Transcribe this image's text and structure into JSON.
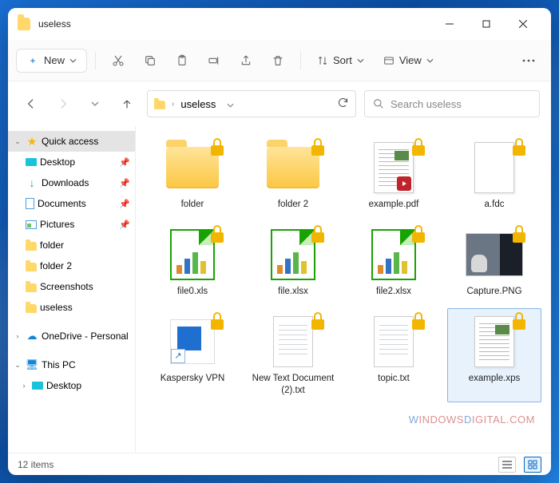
{
  "window": {
    "title": "useless"
  },
  "toolbar": {
    "new_label": "New",
    "sort_label": "Sort",
    "view_label": "View"
  },
  "nav": {
    "breadcrumb": "useless",
    "search_placeholder": "Search useless"
  },
  "sidebar": {
    "items": [
      {
        "label": "Quick access",
        "icon": "star",
        "expanded": true,
        "selected": true
      },
      {
        "label": "Desktop",
        "icon": "desk",
        "pinned": true
      },
      {
        "label": "Downloads",
        "icon": "down",
        "pinned": true
      },
      {
        "label": "Documents",
        "icon": "doc",
        "pinned": true
      },
      {
        "label": "Pictures",
        "icon": "pic",
        "pinned": true
      },
      {
        "label": "folder",
        "icon": "folder"
      },
      {
        "label": "folder 2",
        "icon": "folder"
      },
      {
        "label": "Screenshots",
        "icon": "folder"
      },
      {
        "label": "useless",
        "icon": "folder"
      },
      {
        "label": "OneDrive - Personal",
        "icon": "cloud",
        "expandable": true
      },
      {
        "label": "This PC",
        "icon": "pc",
        "expanded": true
      },
      {
        "label": "Desktop",
        "icon": "desk",
        "expandable": true,
        "indent": true
      }
    ]
  },
  "files": [
    {
      "name": "folder",
      "type": "folder",
      "locked": true
    },
    {
      "name": "folder 2",
      "type": "folder",
      "locked": true
    },
    {
      "name": "example.pdf",
      "type": "pdf",
      "locked": true
    },
    {
      "name": "a.fdc",
      "type": "blank",
      "locked": true
    },
    {
      "name": "file0.xls",
      "type": "xls",
      "locked": true
    },
    {
      "name": "file.xlsx",
      "type": "xls",
      "locked": true
    },
    {
      "name": "file2.xlsx",
      "type": "xls",
      "locked": true
    },
    {
      "name": "Capture.PNG",
      "type": "image",
      "locked": true
    },
    {
      "name": "Kaspersky VPN",
      "type": "shortcut",
      "locked": true
    },
    {
      "name": "New Text Document (2).txt",
      "type": "txt",
      "locked": true
    },
    {
      "name": "topic.txt",
      "type": "txt",
      "locked": true
    },
    {
      "name": "example.xps",
      "type": "xps",
      "locked": true,
      "selected": true
    }
  ],
  "status": {
    "count_label": "12 items"
  },
  "watermark": {
    "text1": "W",
    "text2": "INDOWS",
    "text3": "D",
    "text4": "IGITAL.COM"
  }
}
